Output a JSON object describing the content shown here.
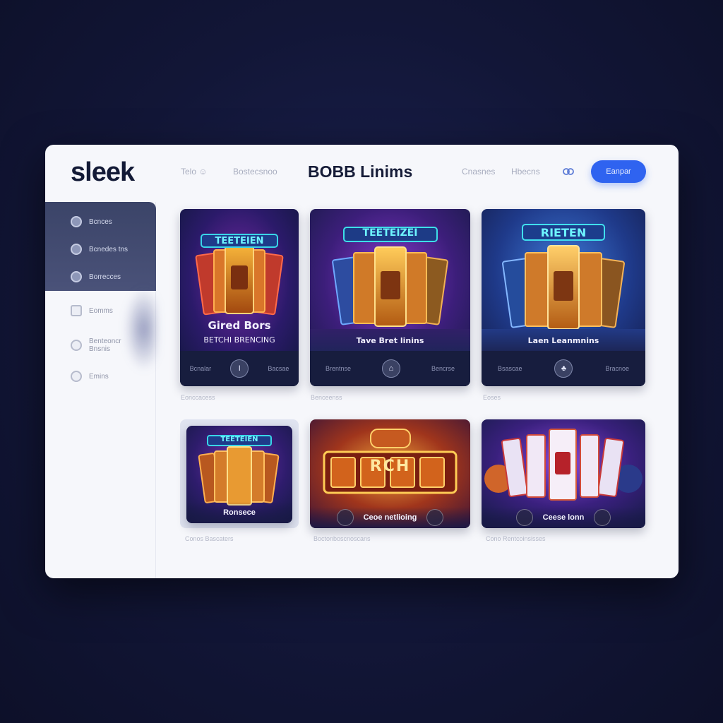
{
  "app": {
    "logo": "sleek",
    "header_title": "BOBB Linims",
    "nav_links": [
      "Telo ☺",
      "Bostecsnoo",
      "Cnasnes",
      "Hbecns"
    ],
    "cta_label": "Eanpar",
    "header_icon": "link-icon",
    "colors": {
      "accent": "#2f63f0",
      "sidebar_active": "#3b4468",
      "card_footer": "#171d3e",
      "background": "#121637"
    }
  },
  "sidebar": {
    "items": [
      {
        "label": "Bcnces",
        "icon": "home-icon"
      },
      {
        "label": "Bcnedes tns",
        "icon": "shield-icon"
      },
      {
        "label": "Borrecces",
        "icon": "chat-icon"
      },
      {
        "label": "Eomms",
        "icon": "hexagon-icon"
      },
      {
        "label": "Benteoncr Bnsnis",
        "icon": "lock-icon"
      },
      {
        "label": "Emins",
        "icon": "settings-icon"
      }
    ]
  },
  "cards": [
    {
      "banner": "TEETEIEN",
      "title": "Gired Bors",
      "subtitle": "BETCHI BRENCING",
      "footer_left": "Bcnalar",
      "footer_btn": "I",
      "footer_right": "Bacsae",
      "caption": "Eonccacess"
    },
    {
      "banner": "TEETEIZEI",
      "title": "",
      "subtitle": "Tave Bret linins",
      "footer_left": "Brentnse",
      "footer_btn": "⌂",
      "footer_right": "Bencrse",
      "caption": "Benceenss"
    },
    {
      "banner": "RIETEN",
      "title": "",
      "subtitle": "Laen Leanmnins",
      "footer_left": "Bsascae",
      "footer_btn": "♣",
      "footer_right": "Bracnoe",
      "caption": "Eoses"
    },
    {
      "banner": "TEETEIEN",
      "label": "Ronsece",
      "caption": "Conos Bascaters"
    },
    {
      "banner": "RCH",
      "label": "Ceoe netlioing",
      "caption": "Boctonboscnoscans"
    },
    {
      "banner": "",
      "label": "Ceese lonn",
      "caption": "Cono Rentcoinsisses"
    }
  ]
}
